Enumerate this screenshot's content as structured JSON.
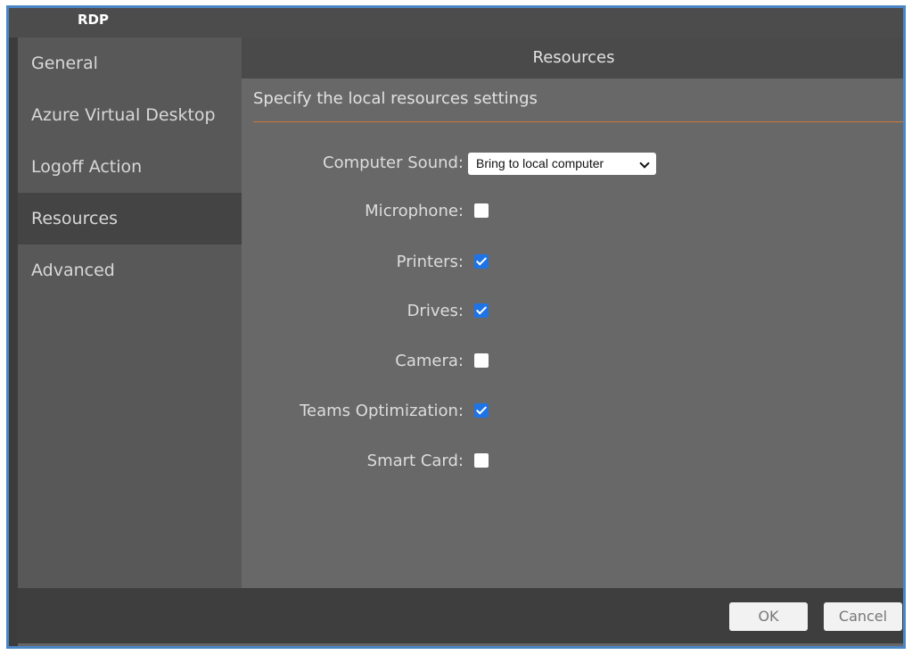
{
  "window": {
    "title": "RDP"
  },
  "sidebar": {
    "items": [
      {
        "label": "General",
        "active": false
      },
      {
        "label": "Azure Virtual Desktop",
        "active": false
      },
      {
        "label": "Logoff Action",
        "active": false
      },
      {
        "label": "Resources",
        "active": true
      },
      {
        "label": "Advanced",
        "active": false
      }
    ]
  },
  "main": {
    "header": "Resources",
    "subtitle": "Specify the local resources settings",
    "computer_sound": {
      "label": "Computer Sound:",
      "selected": "Bring to local computer"
    },
    "options": [
      {
        "label": "Microphone:",
        "checked": false
      },
      {
        "label": "Printers:",
        "checked": true
      },
      {
        "label": "Drives:",
        "checked": true
      },
      {
        "label": "Camera:",
        "checked": false
      },
      {
        "label": "Teams Optimization:",
        "checked": true
      },
      {
        "label": "Smart Card:",
        "checked": false
      }
    ]
  },
  "footer": {
    "ok_label": "OK",
    "cancel_label": "Cancel"
  },
  "colors": {
    "accent_line": "#cf7a3a",
    "checkbox_checked": "#1e74e6",
    "window_border": "#4a86c5"
  }
}
